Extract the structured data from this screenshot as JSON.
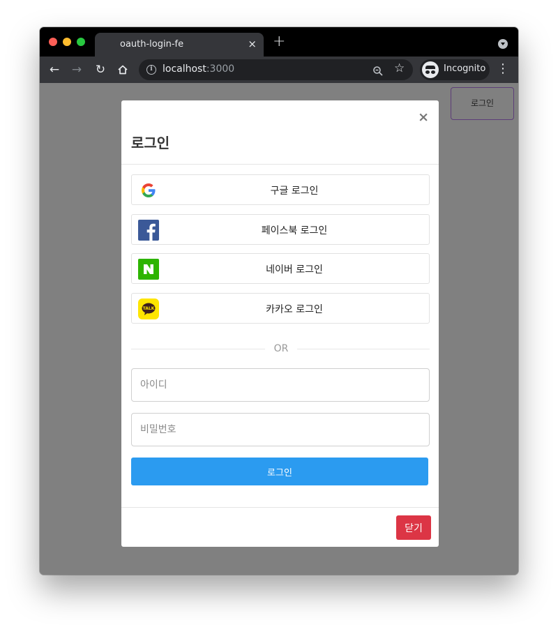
{
  "browser": {
    "tab_title": "oauth-login-fe",
    "tab_close": "×",
    "new_tab": "+",
    "url_host": "localhost",
    "url_port": ":3000",
    "incognito_label": "Incognito"
  },
  "page": {
    "header_login_label": "로그인"
  },
  "modal": {
    "close_glyph": "×",
    "title": "로그인",
    "social": [
      {
        "id": "google",
        "label": "구글 로그인",
        "icon": "google-icon"
      },
      {
        "id": "facebook",
        "label": "페이스북 로그인",
        "icon": "facebook-icon"
      },
      {
        "id": "naver",
        "label": "네이버 로그인",
        "icon": "naver-icon"
      },
      {
        "id": "kakao",
        "label": "카카오 로그인",
        "icon": "kakao-icon"
      }
    ],
    "divider_text": "OR",
    "id_placeholder": "아이디",
    "password_placeholder": "비밀번호",
    "submit_label": "로그인",
    "close_button_label": "닫기"
  },
  "colors": {
    "submit": "#2b9bf0",
    "close_button": "#dc3545",
    "facebook": "#3b5998",
    "naver": "#2db400",
    "kakao": "#fee500"
  }
}
